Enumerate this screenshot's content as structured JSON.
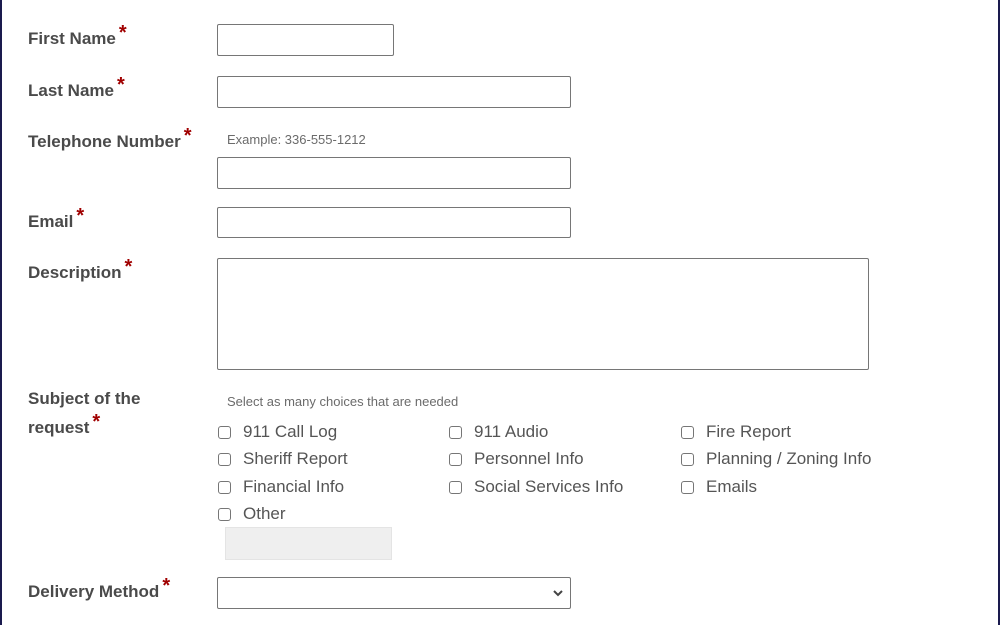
{
  "form": {
    "required_marker": "*",
    "first_name": {
      "label": "First Name",
      "value": ""
    },
    "last_name": {
      "label": "Last Name",
      "value": ""
    },
    "telephone": {
      "label": "Telephone Number",
      "hint": "Example: 336-555-1212",
      "value": ""
    },
    "email": {
      "label": "Email",
      "value": ""
    },
    "description": {
      "label": "Description",
      "value": ""
    },
    "subject": {
      "label_line1": "Subject of the",
      "label_line2": "request",
      "hint": "Select as many choices that are needed",
      "options": [
        {
          "label": "911 Call Log",
          "checked": false
        },
        {
          "label": "911 Audio",
          "checked": false
        },
        {
          "label": "Fire Report",
          "checked": false
        },
        {
          "label": "Sheriff Report",
          "checked": false
        },
        {
          "label": "Personnel Info",
          "checked": false
        },
        {
          "label": "Planning / Zoning Info",
          "checked": false
        },
        {
          "label": "Financial Info",
          "checked": false
        },
        {
          "label": "Social Services Info",
          "checked": false
        },
        {
          "label": "Emails",
          "checked": false
        },
        {
          "label": "Other",
          "checked": false
        }
      ],
      "other_value": ""
    },
    "delivery": {
      "label": "Delivery Method",
      "selected": ""
    }
  }
}
